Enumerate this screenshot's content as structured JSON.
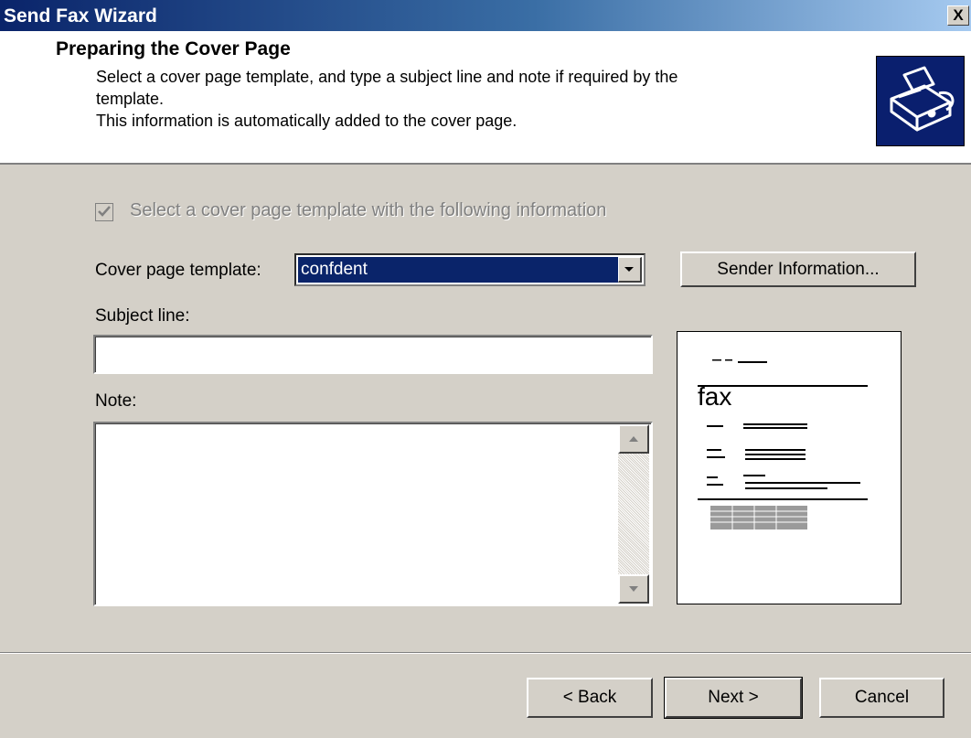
{
  "window": {
    "title": "Send Fax Wizard",
    "close_label": "X"
  },
  "header": {
    "title": "Preparing the Cover Page",
    "description_line1": "Select a cover page template, and type a subject line and note if required by the",
    "description_line2": "template.",
    "description_line3": "This information is automatically added to the cover page.",
    "icon": "fax-machine-icon"
  },
  "form": {
    "use_template_checkbox": {
      "label": "Select a cover page template with the following information",
      "checked": true,
      "disabled": true
    },
    "template_label": "Cover page template:",
    "template_value": "confdent",
    "sender_info_button": "Sender Information...",
    "subject_label": "Subject line:",
    "subject_value": "",
    "note_label": "Note:",
    "note_value": ""
  },
  "preview": {
    "fax_text": "fax"
  },
  "buttons": {
    "back": "< Back",
    "next": "Next >",
    "cancel": "Cancel"
  },
  "colors": {
    "title_bar_start": "#0a246a",
    "title_bar_end": "#a6caf0",
    "dialog_background": "#d4d0c8",
    "selection": "#0a246a"
  }
}
